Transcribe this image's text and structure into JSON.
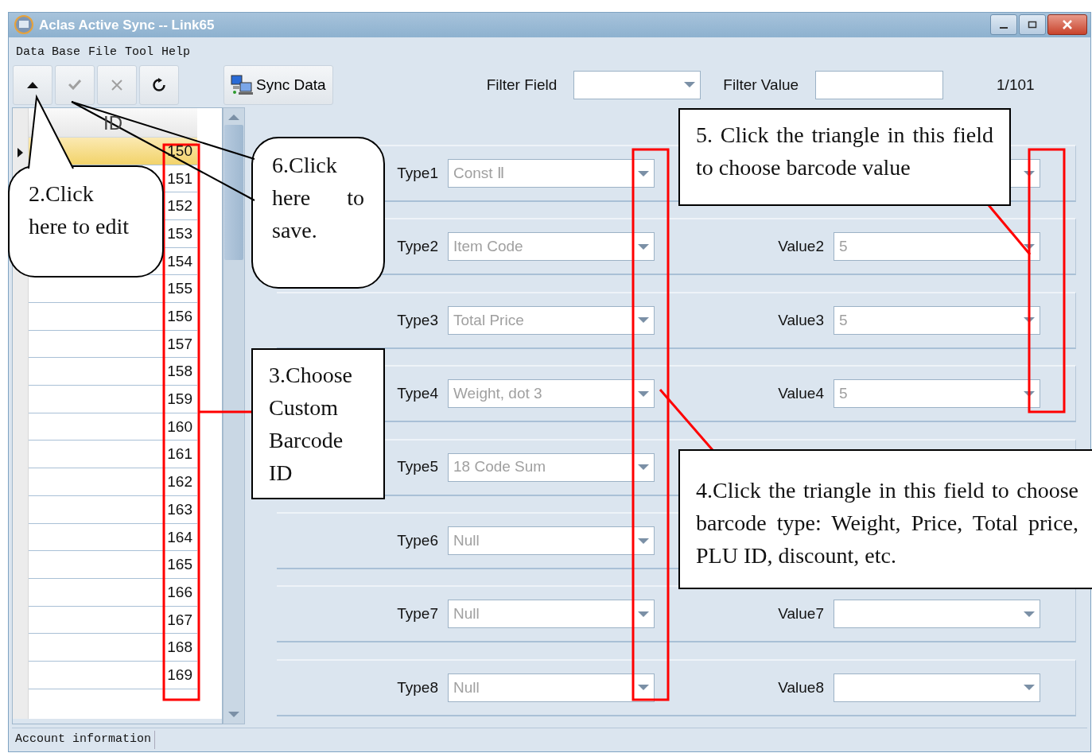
{
  "window": {
    "title": "Aclas Active Sync -- Link65"
  },
  "menu": [
    "Data Base",
    "File",
    "Tool",
    "Help"
  ],
  "toolbar": {
    "buttons": [
      {
        "kind": "up",
        "disabled": false
      },
      {
        "kind": "check",
        "disabled": true
      },
      {
        "kind": "cross",
        "disabled": true
      },
      {
        "kind": "refresh",
        "disabled": false
      }
    ],
    "sync_button": "Sync Data"
  },
  "filter": {
    "field_label": "Filter Field",
    "value_label": "Filter Value",
    "record_count": "1/101"
  },
  "table": {
    "column": "ID",
    "rows": [
      {
        "id": "150",
        "selected": true
      },
      {
        "id": "151",
        "selected": false
      },
      {
        "id": "152",
        "selected": false
      },
      {
        "id": "153",
        "selected": false
      },
      {
        "id": "154",
        "selected": false
      },
      {
        "id": "155",
        "selected": false
      },
      {
        "id": "156",
        "selected": false
      },
      {
        "id": "157",
        "selected": false
      },
      {
        "id": "158",
        "selected": false
      },
      {
        "id": "159",
        "selected": false
      },
      {
        "id": "160",
        "selected": false
      },
      {
        "id": "161",
        "selected": false
      },
      {
        "id": "162",
        "selected": false
      },
      {
        "id": "163",
        "selected": false
      },
      {
        "id": "164",
        "selected": false
      },
      {
        "id": "165",
        "selected": false
      },
      {
        "id": "166",
        "selected": false
      },
      {
        "id": "167",
        "selected": false
      },
      {
        "id": "168",
        "selected": false
      },
      {
        "id": "169",
        "selected": false
      }
    ]
  },
  "barcode_fields": [
    {
      "type_label": "Type1",
      "type_value": "Const Ⅱ",
      "disabled": true
    },
    {
      "type_label": "Type2",
      "type_value": "Item Code",
      "value_label": "Value2",
      "value": "5",
      "disabled": true
    },
    {
      "type_label": "Type3",
      "type_value": "Total Price",
      "value_label": "Value3",
      "value": "5",
      "disabled": true
    },
    {
      "type_label": "Type4",
      "type_value": "Weight, dot 3",
      "value_label": "Value4",
      "value": "5",
      "disabled": true
    },
    {
      "type_label": "Type5",
      "type_value": "18 Code Sum",
      "disabled": true
    },
    {
      "type_label": "Type6",
      "type_value": "Null",
      "disabled": true
    },
    {
      "type_label": "Type7",
      "type_value": "Null",
      "value_label": "Value7",
      "disabled": true
    },
    {
      "type_label": "Type8",
      "type_value": "Null",
      "value_label": "Value8",
      "disabled": true
    }
  ],
  "status_bar": {
    "text": "Account information"
  },
  "annotations": [
    {
      "kind": "bubble",
      "text": "2.Click\nhere to edit"
    },
    {
      "kind": "bubble",
      "text": "6.Click here to save."
    },
    {
      "kind": "box",
      "text": "3.Choose Custom Barcode ID"
    },
    {
      "kind": "box",
      "text": "5. Click the triangle in this field to choose barcode value"
    },
    {
      "kind": "box",
      "text": "4.Click the triangle in this field to choose barcode type: Weight, Price, Total price, PLU ID, discount, etc."
    }
  ]
}
